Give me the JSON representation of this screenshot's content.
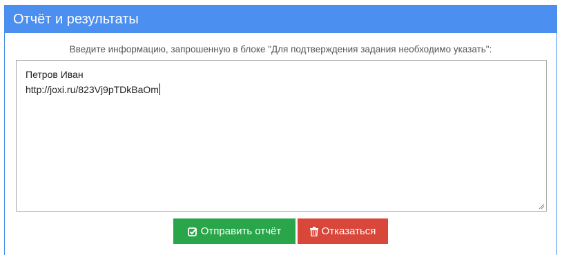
{
  "panel": {
    "title": "Отчёт и результаты"
  },
  "form": {
    "instruction": "Введите информацию, запрошенную в блоке \"Для подтверждения задания необходимо указать\":",
    "report_lines": [
      "Петров Иван",
      "http://joxi.ru/823Vj9pTDkBaOm"
    ]
  },
  "actions": {
    "send_label": "Отправить отчёт",
    "send_icon": "check-square-icon",
    "refuse_label": "Отказаться",
    "refuse_icon": "trash-icon"
  },
  "colors": {
    "header": "#4b8ff0",
    "send": "#2aa64a",
    "refuse": "#d9473a"
  }
}
